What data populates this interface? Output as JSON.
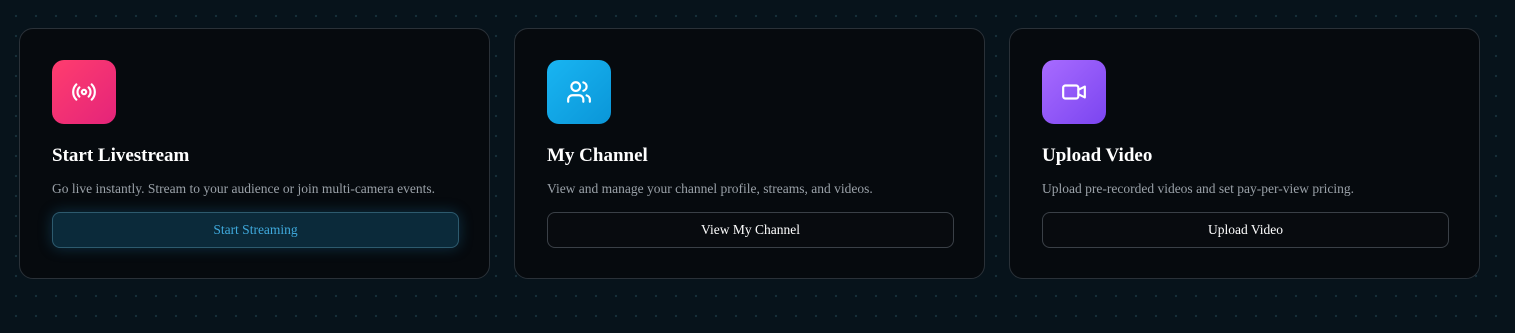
{
  "cards": [
    {
      "title": "Start Livestream",
      "description": "Go live instantly. Stream to your audience or join multi-camera events.",
      "button_label": "Start Streaming",
      "icon": "broadcast-icon",
      "icon_gradient": [
        "#ff3d6e",
        "#e4247a"
      ]
    },
    {
      "title": "My Channel",
      "description": "View and manage your channel profile, streams, and videos.",
      "button_label": "View My Channel",
      "icon": "users-icon",
      "icon_gradient": [
        "#19b5f2",
        "#0a96d8"
      ]
    },
    {
      "title": "Upload Video",
      "description": "Upload pre-recorded videos and set pay-per-view pricing.",
      "button_label": "Upload Video",
      "icon": "video-camera-icon",
      "icon_gradient": [
        "#a86bff",
        "#7b45f0"
      ]
    }
  ]
}
